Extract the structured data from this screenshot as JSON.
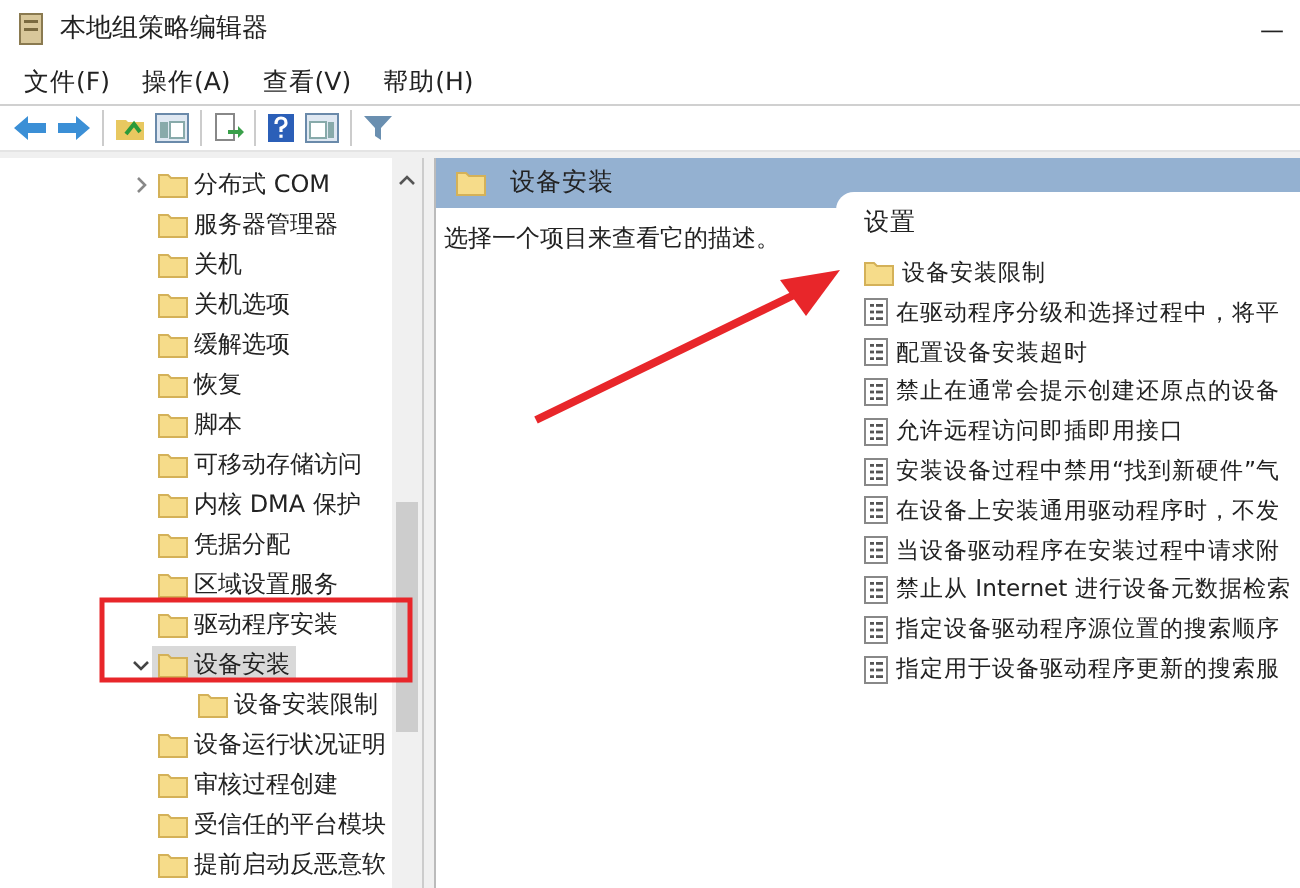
{
  "window": {
    "title": "本地组策略编辑器",
    "minimize": "—"
  },
  "menu": [
    "文件(F)",
    "操作(A)",
    "查看(V)",
    "帮助(H)"
  ],
  "tree": [
    {
      "label": "分布式 COM",
      "expanded": false,
      "selected": false
    },
    {
      "label": "服务器管理器",
      "selected": false
    },
    {
      "label": "关机",
      "selected": false
    },
    {
      "label": "关机选项",
      "selected": false
    },
    {
      "label": "缓解选项",
      "selected": false
    },
    {
      "label": "恢复",
      "selected": false
    },
    {
      "label": "脚本",
      "selected": false
    },
    {
      "label": "可移动存储访问",
      "selected": false
    },
    {
      "label": "内核 DMA 保护",
      "selected": false
    },
    {
      "label": "凭据分配",
      "selected": false
    },
    {
      "label": "区域设置服务",
      "selected": false
    },
    {
      "label": "驱动程序安装",
      "selected": false
    },
    {
      "label": "设备安装",
      "expanded": true,
      "selected": true,
      "children": [
        {
          "label": "设备安装限制",
          "selected": false
        }
      ]
    },
    {
      "label": "设备运行状况证明",
      "selected": false
    },
    {
      "label": "审核过程创建",
      "selected": false
    },
    {
      "label": "受信任的平台模块",
      "selected": false
    },
    {
      "label": "提前启动反恶意软",
      "selected": false
    }
  ],
  "detail": {
    "title": "设备安装",
    "description": "选择一个项目来查看它的描述。",
    "column_header": "设置",
    "items": [
      {
        "kind": "folder",
        "label": "设备安装限制"
      },
      {
        "kind": "setting",
        "label": "在驱动程序分级和选择过程中，将平"
      },
      {
        "kind": "setting",
        "label": "配置设备安装超时"
      },
      {
        "kind": "setting",
        "label": "禁止在通常会提示创建还原点的设备"
      },
      {
        "kind": "setting",
        "label": "允许远程访问即插即用接口"
      },
      {
        "kind": "setting",
        "label": "安装设备过程中禁用“找到新硬件”气"
      },
      {
        "kind": "setting",
        "label": "在设备上安装通用驱动程序时，不发"
      },
      {
        "kind": "setting",
        "label": "当设备驱动程序在安装过程中请求附"
      },
      {
        "kind": "setting",
        "label": "禁止从 Internet 进行设备元数据检索"
      },
      {
        "kind": "setting",
        "label": "指定设备驱动程序源位置的搜索顺序"
      },
      {
        "kind": "setting",
        "label": "指定用于设备驱动程序更新的搜索服"
      }
    ]
  }
}
